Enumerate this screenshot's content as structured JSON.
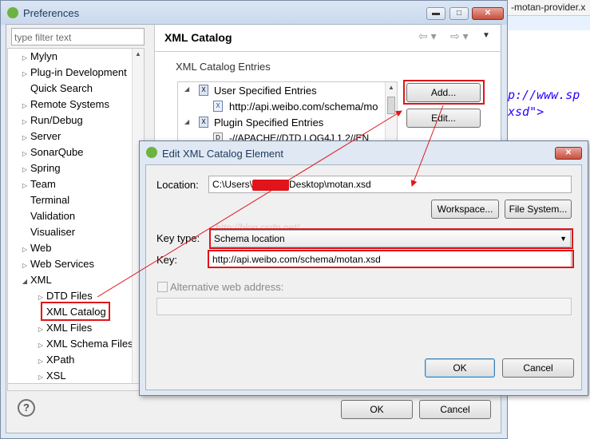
{
  "editor": {
    "filename": "-motan-provider.x",
    "line1_url": "p://www.sp",
    "line2": "xsd\">"
  },
  "prefs": {
    "title": "Preferences",
    "filter_placeholder": "type filter text",
    "panel_title": "XML Catalog",
    "group_title": "XML Catalog Entries",
    "help_icon": "?",
    "ok": "OK",
    "cancel": "Cancel",
    "tree": [
      {
        "label": "Mylyn",
        "tri": "▷"
      },
      {
        "label": "Plug-in Development",
        "tri": "▷"
      },
      {
        "label": "Quick Search",
        "tri": ""
      },
      {
        "label": "Remote Systems",
        "tri": "▷"
      },
      {
        "label": "Run/Debug",
        "tri": "▷"
      },
      {
        "label": "Server",
        "tri": "▷"
      },
      {
        "label": "SonarQube",
        "tri": "▷"
      },
      {
        "label": "Spring",
        "tri": "▷"
      },
      {
        "label": "Team",
        "tri": "▷"
      },
      {
        "label": "Terminal",
        "tri": ""
      },
      {
        "label": "Validation",
        "tri": ""
      },
      {
        "label": "Visualiser",
        "tri": ""
      },
      {
        "label": "Web",
        "tri": "▷"
      },
      {
        "label": "Web Services",
        "tri": "▷"
      },
      {
        "label": "XML",
        "tri": "◢"
      },
      {
        "label": "DTD Files",
        "tri": "▷"
      },
      {
        "label": "XML Catalog",
        "tri": ""
      },
      {
        "label": "XML Files",
        "tri": "▷"
      },
      {
        "label": "XML Schema Files",
        "tri": "▷"
      },
      {
        "label": "XPath",
        "tri": "▷"
      },
      {
        "label": "XSL",
        "tri": "▷"
      }
    ],
    "entries": {
      "user": "User Specified Entries",
      "user_child": "http://api.weibo.com/schema/mo",
      "plugin": "Plugin Specified Entries",
      "plugin_child": "-//APACHE//DTD LOG4J 1.2//EN"
    },
    "add": "Add...",
    "edit": "Edit..."
  },
  "dialog": {
    "title": "Edit XML Catalog Element",
    "location_label": "Location:",
    "location_prefix": "C:\\Users\\",
    "location_suffix": "Desktop\\motan.xsd",
    "workspace": "Workspace...",
    "filesystem": "File System...",
    "keytype_label": "Key type:",
    "keytype_value": "Schema location",
    "key_label": "Key:",
    "key_value": "http://api.weibo.com/schema/motan.xsd",
    "alt_label": "Alternative web address:",
    "ok": "OK",
    "cancel": "Cancel",
    "watermark": "http://blog.csdn.net/"
  },
  "colors": {
    "highlight": "#e0141a",
    "accent": "#3a9a3a"
  }
}
